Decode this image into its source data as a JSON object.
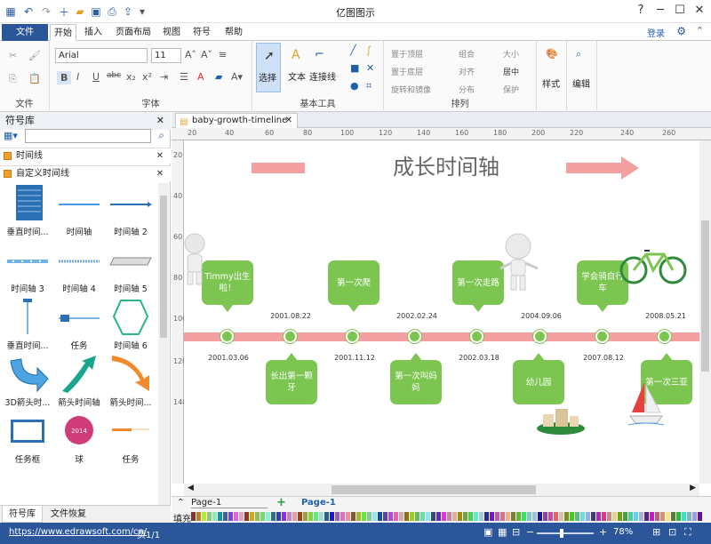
{
  "app": {
    "title": "亿图图示"
  },
  "ribbon_tabs": [
    "文件",
    "开始",
    "插入",
    "页面布局",
    "视图",
    "符号",
    "帮助"
  ],
  "login": "登录",
  "ribbon": {
    "file_group": "文件",
    "font_group": "字体",
    "font_name": "Arial",
    "font_size": "11",
    "basic_tools_group": "基本工具",
    "select_label": "选择",
    "text_label": "文本",
    "connector_label": "连接线",
    "arrange_group": "排列",
    "bring_front": "置于顶层",
    "send_back": "置于底层",
    "rotate_mirror": "旋转和镜像",
    "group": "组合",
    "align": "对齐",
    "distribute": "分布",
    "size": "大小",
    "center": "居中",
    "protect": "保护",
    "style_label": "样式",
    "edit_label": "编辑"
  },
  "sidebar": {
    "title": "符号库",
    "libraries": [
      "时间线",
      "自定义时间线"
    ],
    "shapes": [
      "垂直时间...",
      "时间轴",
      "时间轴 2",
      "时间轴 3",
      "时间轴 4",
      "时间轴 5",
      "垂直时间...",
      "任务",
      "时间轴 6",
      "3D箭头时...",
      "箭头时间轴",
      "箭头时间...",
      "任务框",
      "球",
      "任务"
    ],
    "ball_text": "2014",
    "bottom_tabs": [
      "符号库",
      "文件恢复"
    ]
  },
  "document": {
    "tab_name": "baby-growth-timeline",
    "title": "成长时间轴",
    "ruler_h": [
      "20",
      "40",
      "60",
      "80",
      "100",
      "120",
      "140",
      "160",
      "180",
      "200",
      "220",
      "240",
      "260"
    ],
    "ruler_v": [
      "20",
      "40",
      "60",
      "80",
      "100",
      "120",
      "140"
    ],
    "events_top": [
      {
        "text": "Timmy出生啦！",
        "date": "2001.08.22"
      },
      {
        "text": "第一次爬",
        "date": "2002.02.24"
      },
      {
        "text": "第一次走路",
        "date": "2004.09.06"
      },
      {
        "text": "学会骑自行车",
        "date": "2008.05.21"
      }
    ],
    "events_bottom": [
      {
        "text": "长出第一颗牙",
        "date": "2001.03.06"
      },
      {
        "text": "第一次叫妈妈",
        "date": "2001.11.12"
      },
      {
        "text": "幼儿园",
        "date": "2002.03.18"
      },
      {
        "text": "第一次三亚",
        "date": "2007.08.12"
      }
    ]
  },
  "pagebar": {
    "page_select": "Page-1",
    "page_tab": "Page-1",
    "fill_label": "填充"
  },
  "status": {
    "url": "https://www.edrawsoft.com/cn/",
    "page": "页1/1",
    "zoom": "78%"
  },
  "colors": {
    "accent": "#2b579a",
    "event_green": "#7cc551",
    "axis_pink": "#f4a0a0"
  }
}
